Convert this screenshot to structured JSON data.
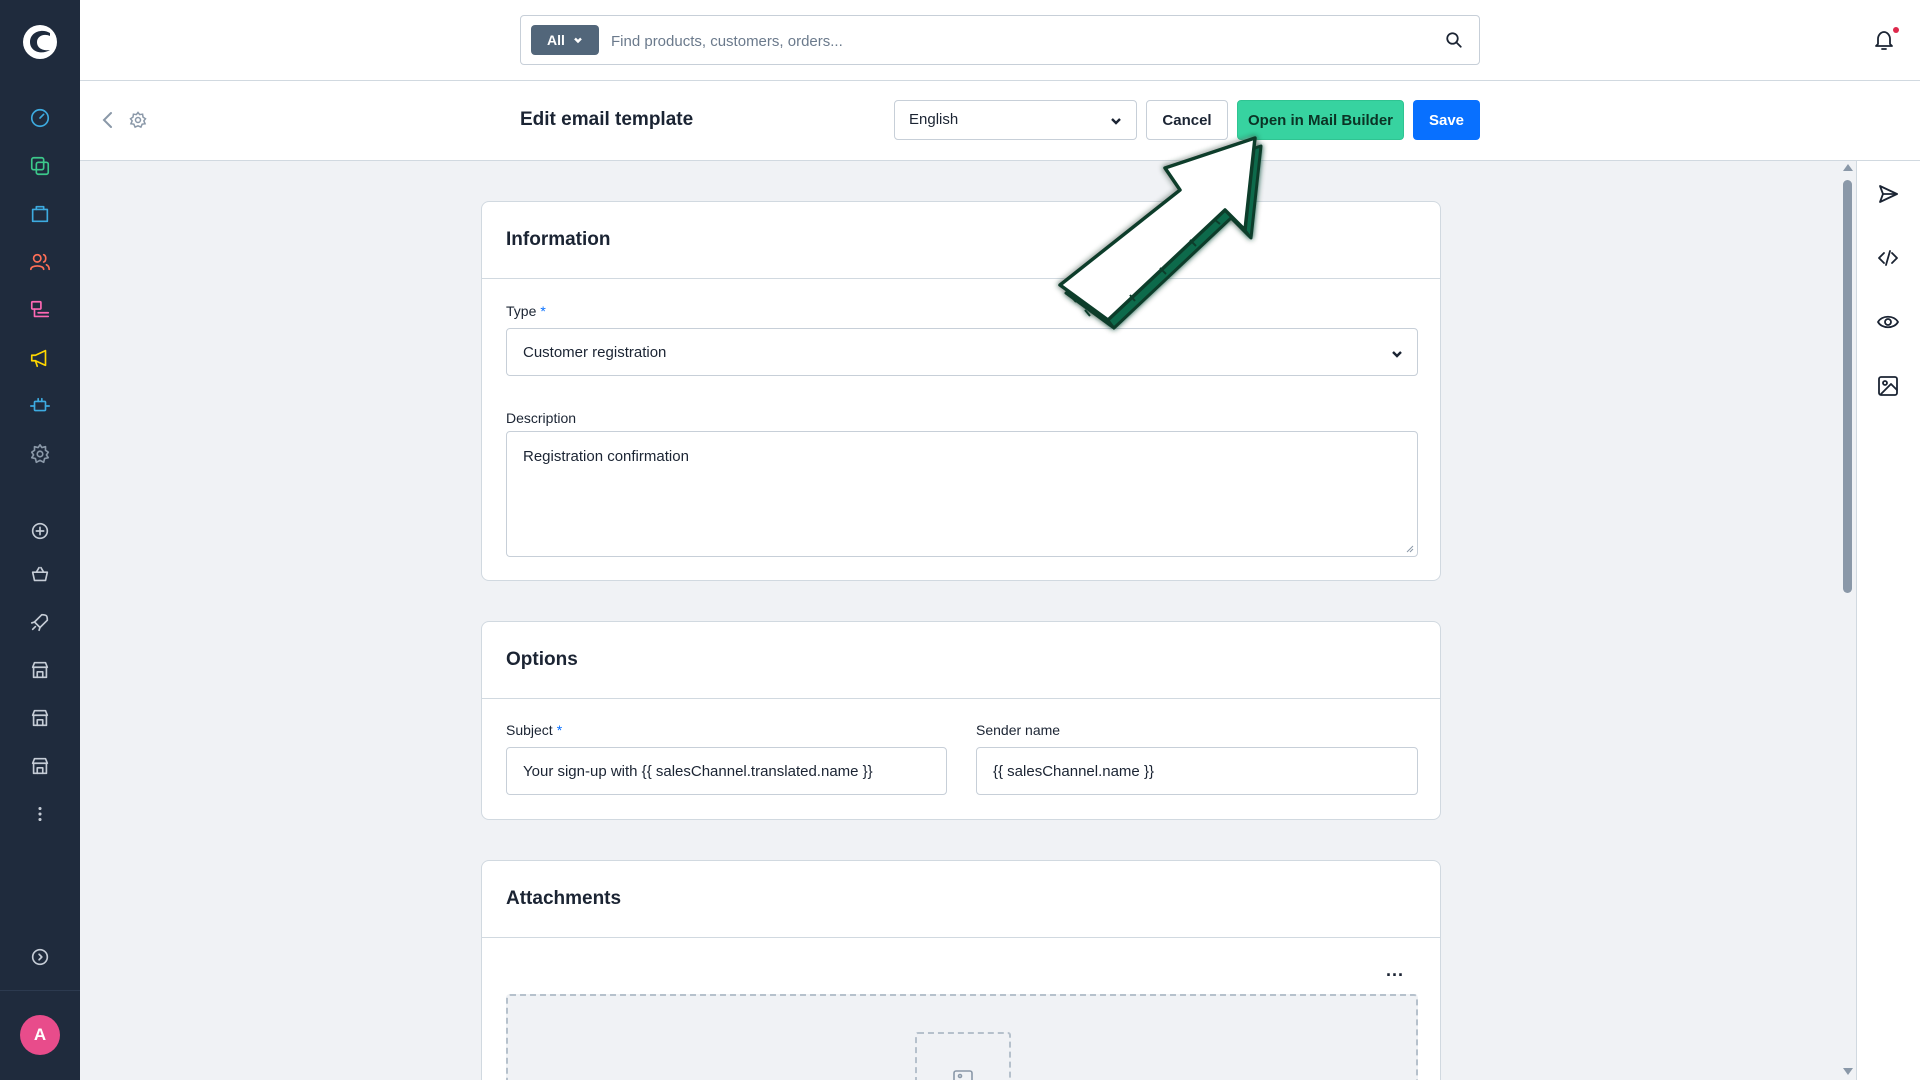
{
  "search": {
    "scope_label": "All",
    "placeholder": "Find products, customers, orders..."
  },
  "sidebar": {
    "items": [
      {
        "icon": "dashboard-icon",
        "color": "#3dabe0"
      },
      {
        "icon": "catalogue-icon",
        "color": "#3cc88b"
      },
      {
        "icon": "orders-icon",
        "color": "#3dabe0"
      },
      {
        "icon": "customers-icon",
        "color": "#ff6f56"
      },
      {
        "icon": "content-icon",
        "color": "#ff68b4"
      },
      {
        "icon": "marketing-icon",
        "color": "#ffd700"
      },
      {
        "icon": "extensions-icon",
        "color": "#3dabe0"
      },
      {
        "icon": "settings-icon",
        "color": "#8a98a8"
      }
    ],
    "avatar_initial": "A"
  },
  "smartbar": {
    "title": "Edit email template",
    "language": "English",
    "cancel_label": "Cancel",
    "mail_builder_label": "Open in Mail Builder",
    "save_label": "Save"
  },
  "information": {
    "title": "Information",
    "type_label": "Type",
    "type_value": "Customer registration",
    "description_label": "Description",
    "description_value": "Registration confirmation"
  },
  "options": {
    "title": "Options",
    "subject_label": "Subject",
    "subject_value": "Your sign-up with {{ salesChannel.translated.name }}",
    "sender_label": "Sender name",
    "sender_value": "{{ salesChannel.name }}"
  },
  "attachments": {
    "title": "Attachments"
  },
  "required_mark": "*",
  "colors": {
    "primary": "#0870ff",
    "mail_builder": "#37d3a0",
    "sidebar_bg": "#1f2b3d",
    "avatar": "#e84c8b"
  }
}
